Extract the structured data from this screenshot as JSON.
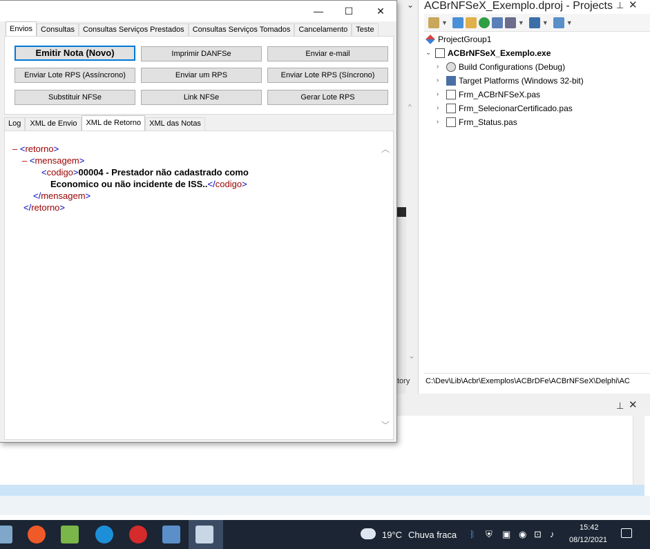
{
  "window": {
    "minimize": "—",
    "maximize": "☐",
    "close": "✕"
  },
  "tabs_top": [
    "Envios",
    "Consultas",
    "Consultas Serviços Prestados",
    "Consultas Serviços Tomados",
    "Cancelamento",
    "Teste"
  ],
  "buttons": {
    "emitir": "Emitir Nota (Novo)",
    "imprimir": "Imprimir DANFSe",
    "email": "Enviar e-mail",
    "lote_async": "Enviar Lote RPS (Assíncrono)",
    "um_rps": "Enviar um RPS",
    "lote_sync": "Enviar Lote RPS (Síncrono)",
    "substituir": "Substituir NFSe",
    "link": "Link NFSe",
    "gerar": "Gerar Lote RPS"
  },
  "tabs_mid": [
    "Log",
    "XML de Envio",
    "XML de Retorno",
    "XML das Notas"
  ],
  "xml": {
    "retorno_open": "retorno",
    "mensagem_open": "mensagem",
    "codigo_open": "codigo",
    "codigo_text_1": "00004 - Prestador não cadastrado como",
    "codigo_text_2": "Economico ou não incidente de ISS..",
    "codigo_close": "codigo",
    "mensagem_close": "mensagem",
    "retorno_close": "retorno"
  },
  "projects": {
    "title": "ACBrNFSeX_Exemplo.dproj - Projects",
    "group": "ProjectGroup1",
    "exe": "ACBrNFSeX_Exemplo.exe",
    "items": [
      "Build Configurations (Debug)",
      "Target Platforms (Windows 32-bit)",
      "Frm_ACBrNFSeX.pas",
      "Frm_SelecionarCertificado.pas",
      "Frm_Status.pas"
    ],
    "path": "C:\\Dev\\Lib\\Acbr\\Exemplos\\ACBrDFe\\ACBrNFSeX\\Delphi\\AC",
    "story_fragment": "tory"
  },
  "taskbar": {
    "temp": "19°C",
    "weather": "Chuva fraca",
    "time": "15:42",
    "date": "08/12/2021"
  }
}
